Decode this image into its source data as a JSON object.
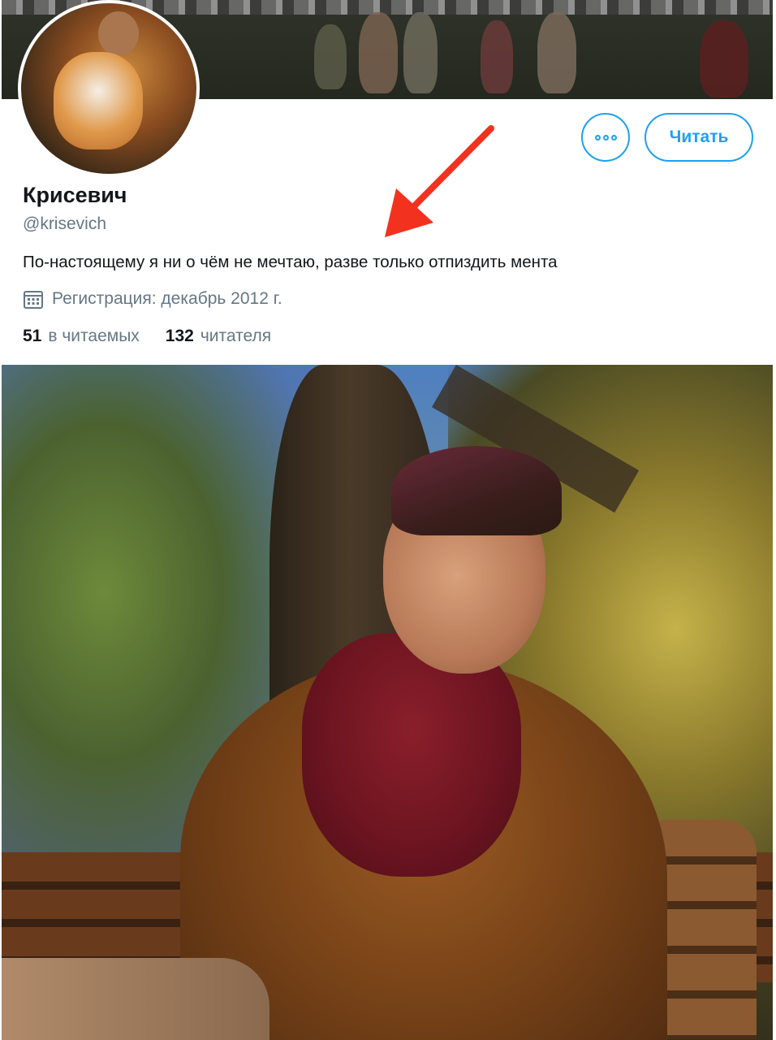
{
  "profile": {
    "display_name": "Крисевич",
    "handle": "@krisevich",
    "bio": "По-настоящему я ни о чём не мечтаю, разве только отпиздить мента",
    "joined": "Регистрация: декабрь 2012 г.",
    "following_count": "51",
    "following_label": "в читаемых",
    "followers_count": "132",
    "followers_label": "читателя"
  },
  "actions": {
    "follow_label": "Читать",
    "more_icon": "more-dots-icon"
  },
  "icons": {
    "joined": "calendar-icon",
    "annotation": "red-arrow-icon"
  },
  "colors": {
    "accent": "#1da1f2",
    "text_primary": "#14171a",
    "text_secondary": "#657786",
    "annotation": "#f2321f"
  }
}
